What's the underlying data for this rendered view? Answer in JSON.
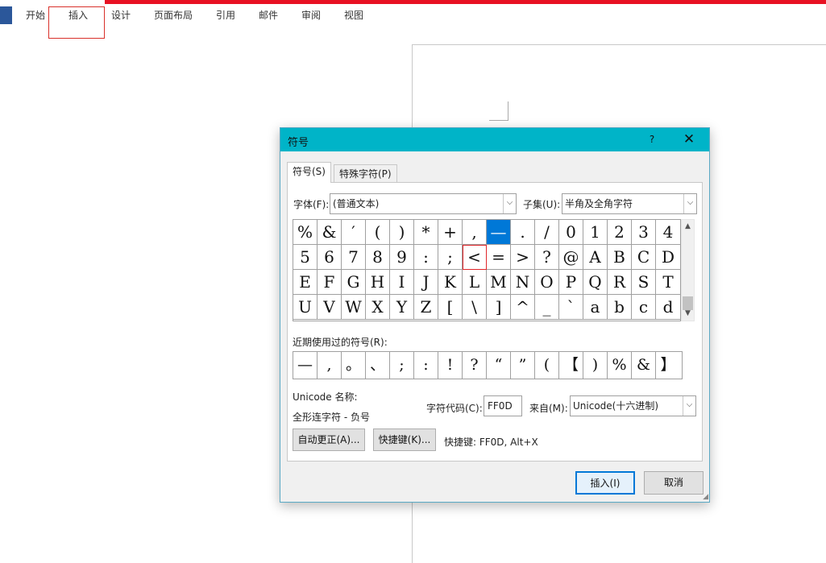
{
  "ribbon": {
    "tabs": [
      "开始",
      "插入",
      "设计",
      "页面布局",
      "引用",
      "邮件",
      "审阅",
      "视图"
    ],
    "accent": "#e81123"
  },
  "dialog": {
    "title": "符号",
    "help": "?",
    "close": "✕",
    "tabs": [
      "符号(S)",
      "特殊字符(P)"
    ],
    "font_label": "字体(F):",
    "font_value": "(普通文本)",
    "subset_label": "子集(U):",
    "subset_value": "半角及全角字符",
    "symbol_rows": [
      [
        "%",
        "&",
        "′",
        "(",
        ")",
        "*",
        "+",
        ",",
        "—",
        ".",
        "/",
        "0",
        "1",
        "2",
        "3",
        "4"
      ],
      [
        "5",
        "6",
        "7",
        "8",
        "9",
        ":",
        ";",
        "<",
        "=",
        ">",
        "?",
        "@",
        "A",
        "B",
        "C",
        "D"
      ],
      [
        "E",
        "F",
        "G",
        "H",
        "I",
        "J",
        "K",
        "L",
        "M",
        "N",
        "O",
        "P",
        "Q",
        "R",
        "S",
        "T"
      ],
      [
        "U",
        "V",
        "W",
        "X",
        "Y",
        "Z",
        "[",
        "\\",
        "]",
        "^",
        "_",
        "`",
        "a",
        "b",
        "c",
        "d"
      ]
    ],
    "selected_symbol": "—",
    "recent_label": "近期使用过的符号(R):",
    "recent_symbols": [
      "—",
      ",",
      "。",
      "、",
      ";",
      ":",
      "!",
      "?",
      "“",
      "”",
      "(",
      "【",
      ")",
      "%",
      "&",
      "】"
    ],
    "unicode_name_label": "Unicode 名称:",
    "unicode_name_value": "全形连字符 - 负号",
    "char_code_label": "字符代码(C):",
    "char_code_value": "FF0D",
    "from_label": "来自(M):",
    "from_value": "Unicode(十六进制)",
    "autocorrect_button": "自动更正(A)...",
    "shortcut_button": "快捷键(K)...",
    "shortcut_text": "快捷键: FF0D, Alt+X",
    "insert_button": "插入(I)",
    "cancel_button": "取消",
    "titlebar_color": "#00b4c8",
    "selection_color": "#0078d7"
  }
}
